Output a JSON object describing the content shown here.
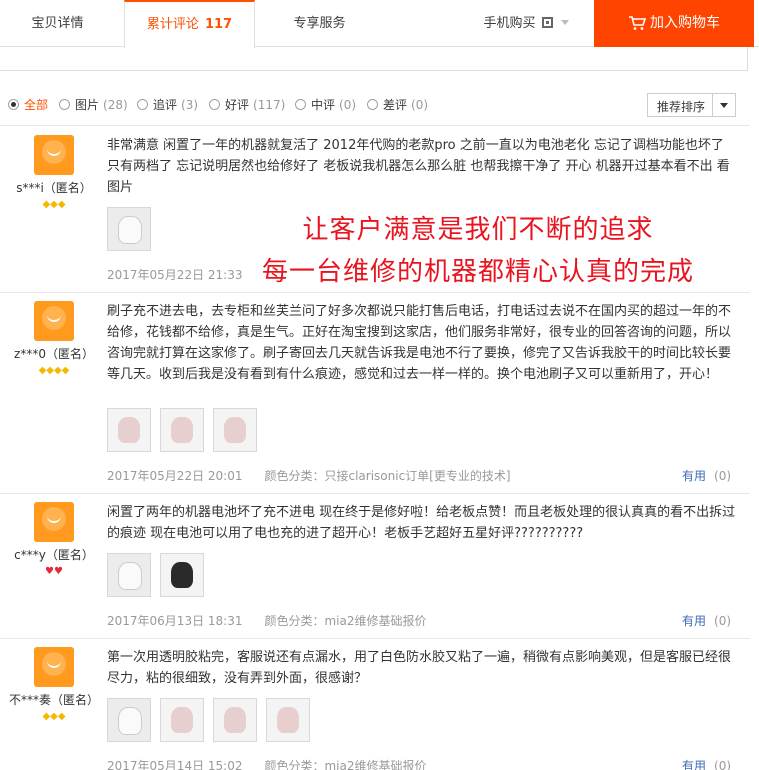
{
  "tabs": {
    "detail": "宝贝详情",
    "reviews": "累计评论",
    "reviews_count": "117",
    "service": "专享服务",
    "mobile_buy": "手机购买",
    "add_to_cart": "加入购物车"
  },
  "filters": [
    {
      "label": "全部",
      "count": "",
      "checked": true
    },
    {
      "label": "图片",
      "count": "(28)"
    },
    {
      "label": "追评",
      "count": "(3)"
    },
    {
      "label": "好评",
      "count": "(117)"
    },
    {
      "label": "中评",
      "count": "(0)"
    },
    {
      "label": "差评",
      "count": "(0)"
    }
  ],
  "sort": {
    "label": "推荐排序"
  },
  "overlay": {
    "line1": "让客户满意是我们不断的追求",
    "line2": "每一台维修的机器都精心认真的完成"
  },
  "reviews": [
    {
      "user": "s***i（匿名）",
      "rank": "◆◆◆",
      "text": "非常满意 闲置了一年的机器就复活了 2012年代购的老款pro 之前一直以为电池老化 忘记了调档功能也坏了 只有两档了 忘记说明居然也给修好了 老板说我机器怎么那么脏 也帮我擦干净了 开心 机器开过基本看不出 看图片",
      "date": "2017年05月22日 21:33",
      "sku": "",
      "useful_label": "",
      "useful_count": ""
    },
    {
      "user": "z***0（匿名）",
      "rank": "◆◆◆◆",
      "text": "刷子充不进去电，去专柜和丝芙兰问了好多次都说只能打售后电话，打电话过去说不在国内买的超过一年的不给修，花钱都不给修，真是生气。正好在淘宝搜到这家店，他们服务非常好，很专业的回答咨询的问题，所以咨询完就打算在这家修了。刷子寄回去几天就告诉我是电池不行了要换，修完了又告诉我胶干的时间比较长要等几天。收到后我是没有看到有什么痕迹，感觉和过去一样一样的。换个电池刷子又可以重新用了，开心！",
      "date": "2017年05月22日 20:01",
      "sku": "颜色分类：只接clarisonic订单[更专业的技术]",
      "useful_label": "有用",
      "useful_count": "(0)"
    },
    {
      "user": "c***y（匿名）",
      "rank": "♥♥",
      "text": "闲置了两年的机器电池坏了充不进电 现在终于是修好啦！给老板点赞！而且老板处理的很认真真的看不出拆过的痕迹 现在电池可以用了电也充的进了超开心！老板手艺超好五星好评??????????",
      "date": "2017年06月13日 18:31",
      "sku": "颜色分类：mia2维修基础报价",
      "useful_label": "有用",
      "useful_count": "(0)"
    },
    {
      "user": "不***奏（匿名）",
      "rank": "◆◆◆",
      "text": "第一次用透明胶粘完，客服说还有点漏水，用了白色防水胶又粘了一遍，稍微有点影响美观，但是客服已经很尽力，粘的很细致，没有弄到外面，很感谢？",
      "date": "2017年05月14日 15:02",
      "sku": "颜色分类：mia2维修基础报价",
      "useful_label": "有用",
      "useful_count": "(0)"
    }
  ]
}
